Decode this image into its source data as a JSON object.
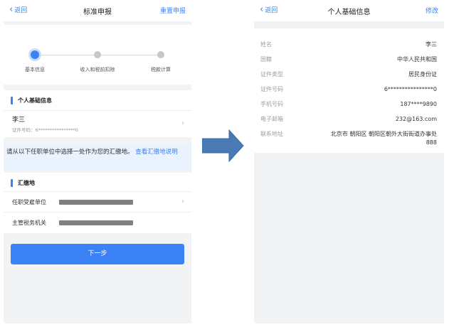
{
  "left": {
    "nav": {
      "back": "返回",
      "title": "标准申报",
      "action": "重置申报"
    },
    "steps": [
      "基本信息",
      "收入和税前扣除",
      "税款计算"
    ],
    "section_personal": "个人基础信息",
    "person": {
      "name": "李三",
      "id": "证件号码：6****************0"
    },
    "notice": {
      "text": "请从以下任职单位中选择一处作为您的汇缴地。",
      "link": "查看汇缴地说明"
    },
    "section_remit": "汇缴地",
    "rows": [
      {
        "label": "任职受雇单位"
      },
      {
        "label": "主管税务机关"
      }
    ],
    "next_button": "下一步"
  },
  "right": {
    "nav": {
      "back": "返回",
      "title": "个人基础信息",
      "action": "修改"
    },
    "fields": [
      {
        "label": "姓名",
        "value": "李三"
      },
      {
        "label": "国籍",
        "value": "中华人民共和国"
      },
      {
        "label": "证件类型",
        "value": "居民身份证"
      },
      {
        "label": "证件号码",
        "value": "6****************0"
      },
      {
        "label": "手机号码",
        "value": "187****9890"
      },
      {
        "label": "电子邮箱",
        "value": "232@163.com"
      },
      {
        "label": "联系地址",
        "value": "北京市 朝阳区 朝阳区朝外大街街道办事处 888"
      }
    ]
  },
  "colors": {
    "accent": "#3b82f6",
    "arrow": "#4a7ab5",
    "background": "#f2f3f5"
  },
  "icons": [
    "back-chevron-icon",
    "chevron-right-icon",
    "right-arrow-icon"
  ]
}
